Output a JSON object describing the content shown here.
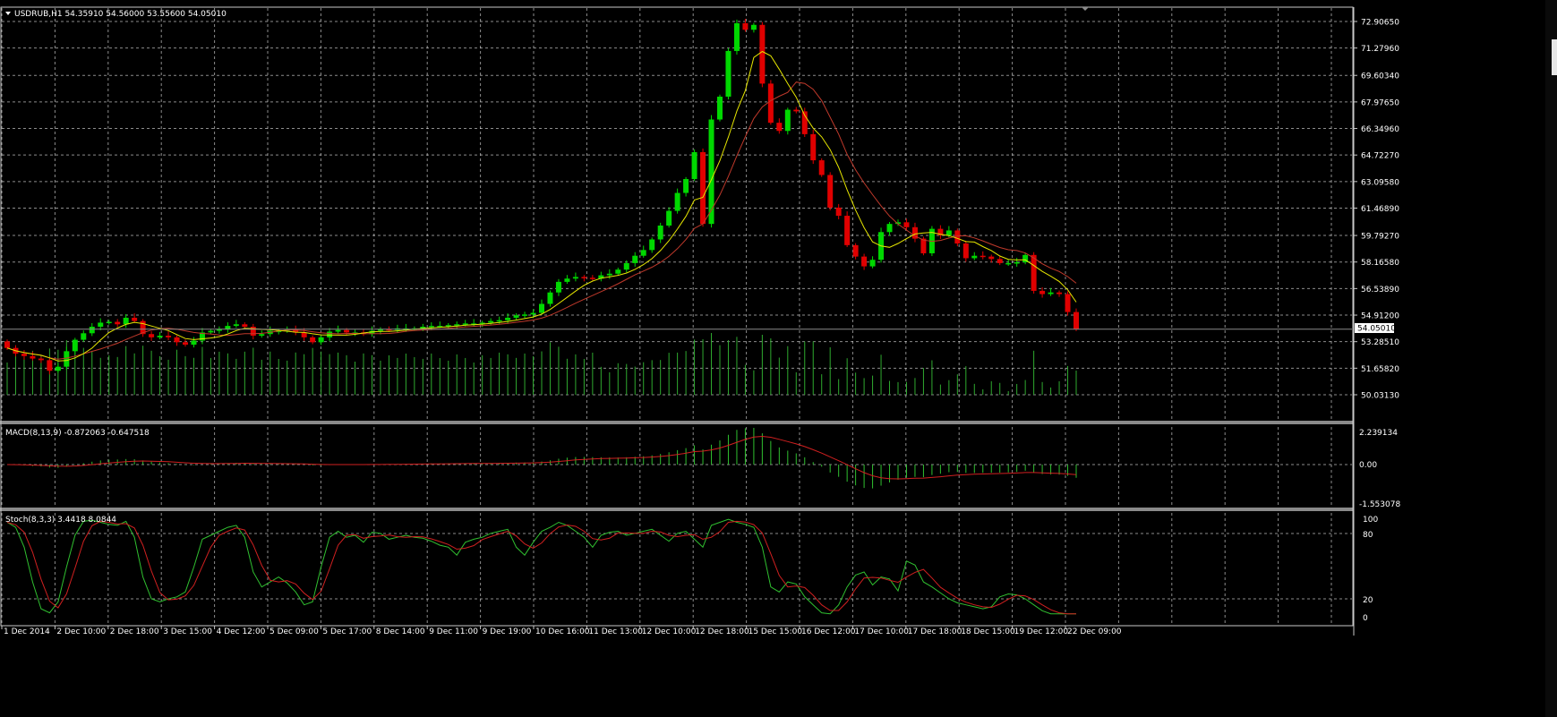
{
  "main_panel": {
    "header": "USDRUB,H1  54.35910 54.56000 53.55600 54.05010",
    "price_ticks": [
      "72.90650",
      "71.27960",
      "69.60340",
      "67.97650",
      "66.34960",
      "64.72270",
      "63.09580",
      "61.46890",
      "59.79270",
      "58.16580",
      "56.53890",
      "54.91200",
      "53.28510",
      "51.65820",
      "50.03130"
    ],
    "current_price": "54.05010",
    "colors": {
      "bull": "#00d800",
      "bear": "#e00000",
      "ma_fast": "#e6e600",
      "ma_slow": "#c0392b",
      "volume": "#2faa2f",
      "grid": "#ffffff",
      "current_line": "#8a8a8a"
    }
  },
  "macd_panel": {
    "header": "MACD(8,13,9) -0.872063 -0.647518",
    "ticks": [
      "2.239134",
      "0.00",
      "-1.553078"
    ]
  },
  "stoch_panel": {
    "header": "Stoch(8,3,3) 3.4418 8.0844",
    "ticks": [
      "100",
      "80",
      "20",
      "0"
    ]
  },
  "time_axis": [
    "1 Dec 2014",
    "2 Dec 10:00",
    "2 Dec 18:00",
    "3 Dec 15:00",
    "4 Dec 12:00",
    "5 Dec 09:00",
    "5 Dec 17:00",
    "8 Dec 14:00",
    "9 Dec 11:00",
    "9 Dec 19:00",
    "10 Dec 16:00",
    "11 Dec 13:00",
    "12 Dec 10:00",
    "12 Dec 18:00",
    "15 Dec 15:00",
    "16 Dec 12:00",
    "17 Dec 10:00",
    "17 Dec 18:00",
    "18 Dec 15:00",
    "19 Dec 12:00",
    "22 Dec 09:00"
  ],
  "series": {
    "closes": [
      52.9,
      52.55,
      52.4,
      52.25,
      52.15,
      51.5,
      51.75,
      52.7,
      53.4,
      53.8,
      54.2,
      54.45,
      54.5,
      54.35,
      54.75,
      54.55,
      53.75,
      53.55,
      53.65,
      53.55,
      53.25,
      53.1,
      53.35,
      53.85,
      53.95,
      54.05,
      54.25,
      54.35,
      54.2,
      53.65,
      53.75,
      53.95,
      53.95,
      54.05,
      53.85,
      53.55,
      53.25,
      53.55,
      53.9,
      54.0,
      53.85,
      53.85,
      53.75,
      53.95,
      54.05,
      54.0,
      54.1,
      54.1,
      54.1,
      54.2,
      54.25,
      54.25,
      54.3,
      54.35,
      54.4,
      54.4,
      54.45,
      54.55,
      54.6,
      54.75,
      54.9,
      54.95,
      55.05,
      55.6,
      56.3,
      56.95,
      57.15,
      57.25,
      57.2,
      57.15,
      57.35,
      57.45,
      57.7,
      58.1,
      58.55,
      58.9,
      59.55,
      60.4,
      61.3,
      62.4,
      63.25,
      64.9,
      60.5,
      66.9,
      68.3,
      71.1,
      72.8,
      72.4,
      72.7,
      69.1,
      66.7,
      66.2,
      67.5,
      67.4,
      66.0,
      64.4,
      63.5,
      61.5,
      61.0,
      59.2,
      58.5,
      57.9,
      58.3,
      60.0,
      60.5,
      60.6,
      60.3,
      59.6,
      58.7,
      60.2,
      59.8,
      60.1,
      59.3,
      58.4,
      58.55,
      58.5,
      58.35,
      58.1,
      58.1,
      58.15,
      58.6,
      56.4,
      56.2,
      56.3,
      56.2,
      55.1,
      54.05
    ],
    "stoch_k": [
      95,
      90,
      70,
      35,
      8,
      4,
      15,
      50,
      82,
      96,
      97,
      95,
      93,
      92,
      96,
      80,
      40,
      18,
      15,
      18,
      20,
      25,
      50,
      78,
      82,
      86,
      90,
      92,
      80,
      45,
      30,
      35,
      40,
      34,
      25,
      12,
      15,
      50,
      80,
      86,
      80,
      82,
      75,
      85,
      84,
      78,
      80,
      82,
      80,
      79,
      76,
      72,
      70,
      62,
      75,
      78,
      80,
      84,
      86,
      88,
      70,
      62,
      75,
      86,
      90,
      95,
      92,
      86,
      80,
      70,
      82,
      85,
      86,
      82,
      84,
      86,
      88,
      82,
      76,
      84,
      86,
      78,
      70,
      92,
      95,
      98,
      95,
      93,
      90,
      70,
      30,
      25,
      35,
      33,
      20,
      12,
      4,
      3,
      12,
      30,
      42,
      45,
      32,
      40,
      38,
      26,
      56,
      52,
      35,
      30,
      24,
      18,
      14,
      12,
      10,
      8,
      10,
      20,
      23,
      22,
      18,
      12,
      6,
      3,
      3,
      3,
      3
    ]
  }
}
